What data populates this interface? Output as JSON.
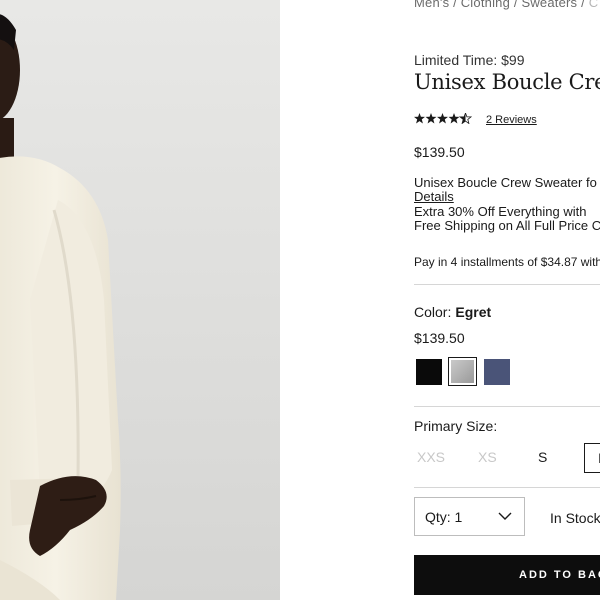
{
  "breadcrumb": {
    "items": [
      "Men's",
      "Clothing",
      "Sweaters"
    ],
    "current": "C",
    "separator": "/"
  },
  "promo": "Limited Time: $99",
  "product": {
    "title": "Unisex Boucle Crew",
    "rating": {
      "value": 4.5,
      "max": 5,
      "stars_glyph": "★★★★★",
      "reviews_label": "2 Reviews"
    },
    "price": "$139.50",
    "lines": [
      "Unisex Boucle Crew Sweater fo",
      "Details",
      "Extra 30% Off Everything with",
      "Free Shipping on All Full Price C"
    ],
    "installments": "Pay in 4 installments of $34.87 with"
  },
  "color": {
    "label": "Color:",
    "selected": "Egret",
    "price": "$139.50",
    "swatches": [
      {
        "name": "Black",
        "hex": "#0a0a0a"
      },
      {
        "name": "Egret",
        "hex": "#b4b4b4"
      },
      {
        "name": "Navy",
        "hex": "#4a5478"
      }
    ]
  },
  "size": {
    "label": "Primary Size:",
    "options": [
      "XXS",
      "XS",
      "S",
      "M"
    ],
    "unavailable": [
      "XXS",
      "XS"
    ],
    "selected": "M"
  },
  "quantity": {
    "label": "Qty: 1"
  },
  "stock": "In Stock",
  "bag_button": "ADD TO BAG"
}
